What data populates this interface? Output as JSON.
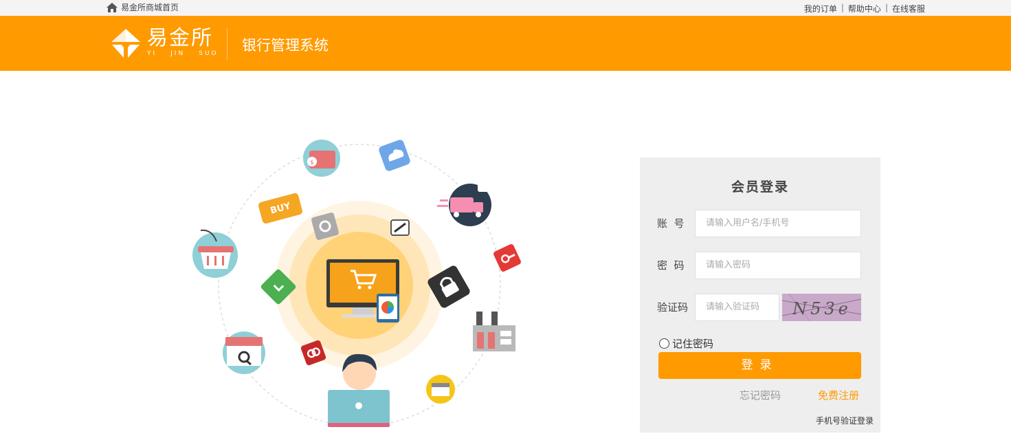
{
  "topbar": {
    "home_label": "易金所商城首页",
    "links": [
      "我的订单",
      "帮助中心",
      "在线客服"
    ],
    "separator": "|"
  },
  "header": {
    "logo_cn": "易金所",
    "logo_en": [
      "YI",
      "JIN",
      "SUO"
    ],
    "system_title": "银行管理系统"
  },
  "illustration": {
    "buy_label": "BUY"
  },
  "login": {
    "title": "会员登录",
    "account_label": "账  号",
    "account_placeholder": "请输入用户名/手机号",
    "password_label": "密  码",
    "password_placeholder": "请输入密码",
    "captcha_label": "验证码",
    "captcha_placeholder": "请输入验证码",
    "captcha_text": "N53e",
    "remember_label": "记住密码",
    "submit_label": "登录",
    "forgot_label": "忘记密码",
    "register_label": "免费注册",
    "phone_login_label": "手机号验证登录"
  },
  "colors": {
    "brand": "#ff9a00",
    "panel_bg": "#eeeeee",
    "topbar_bg": "#f4f4f4"
  }
}
